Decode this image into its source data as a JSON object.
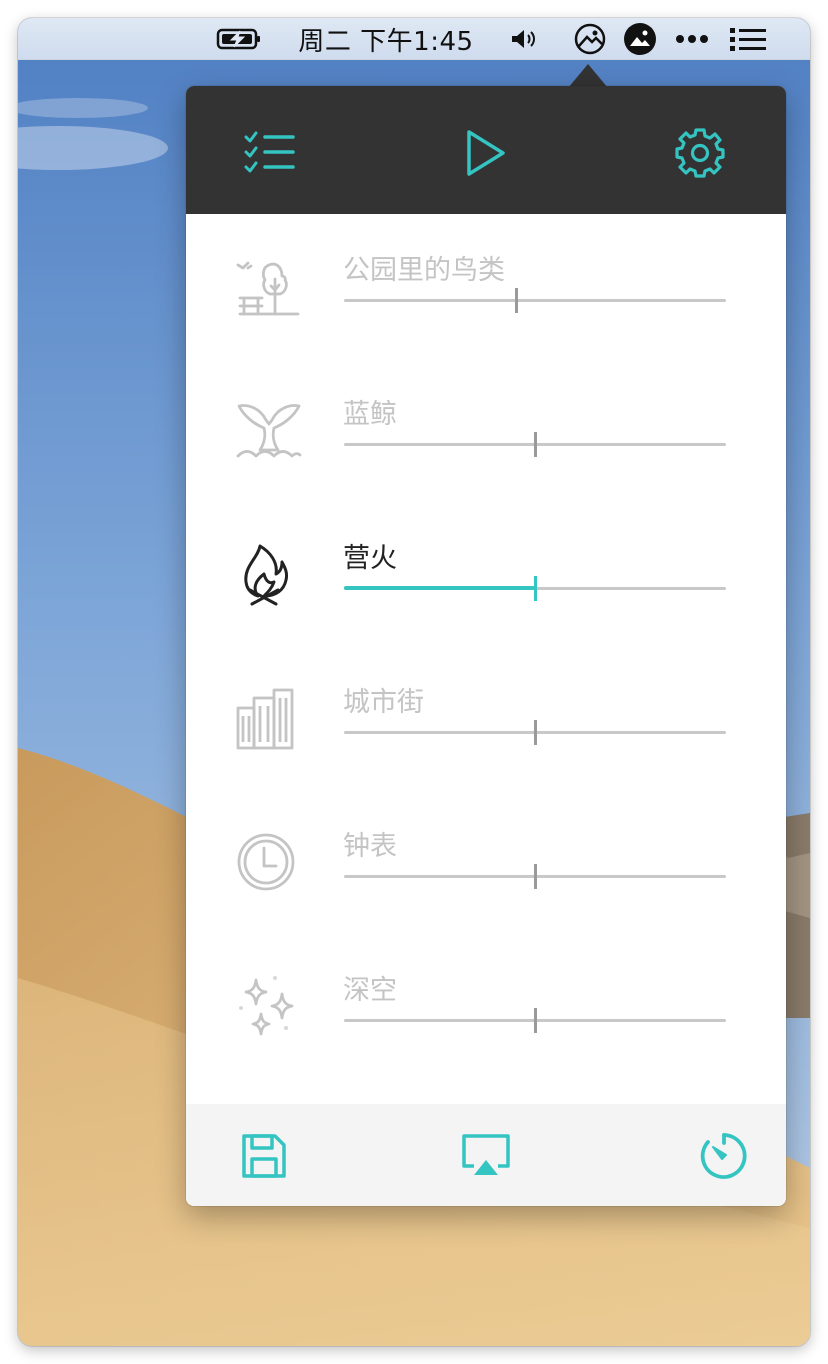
{
  "menubar": {
    "clock": "周二 下午1:45",
    "status_icons": [
      "battery-charging-icon",
      "volume-icon",
      "noizio-app-icon",
      "image-app-icon",
      "more-dots-icon",
      "list-icon"
    ]
  },
  "toolbar": {
    "left_icon": "checklist-icon",
    "center_icon": "play-icon",
    "right_icon": "gear-icon"
  },
  "sounds": [
    {
      "id": "birds",
      "label": "公园里的鸟类",
      "icon": "park-birds-icon",
      "volume": 0.45,
      "active": false
    },
    {
      "id": "whale",
      "label": "蓝鲸",
      "icon": "whale-tail-icon",
      "volume": 0.5,
      "active": false
    },
    {
      "id": "fire",
      "label": "营火",
      "icon": "campfire-icon",
      "volume": 0.5,
      "active": true
    },
    {
      "id": "city",
      "label": "城市街",
      "icon": "city-buildings-icon",
      "volume": 0.5,
      "active": false
    },
    {
      "id": "clock",
      "label": "钟表",
      "icon": "clock-icon",
      "volume": 0.5,
      "active": false
    },
    {
      "id": "space",
      "label": "深空",
      "icon": "stars-icon",
      "volume": 0.5,
      "active": false
    }
  ],
  "footer": {
    "left_icon": "save-icon",
    "center_icon": "airplay-icon",
    "right_icon": "timer-icon"
  },
  "colors": {
    "accent": "#34c4c2",
    "toolbar_bg": "#333333",
    "inactive_text": "#c4c4c4",
    "active_text": "#222222",
    "footer_bg": "#f4f4f4"
  }
}
